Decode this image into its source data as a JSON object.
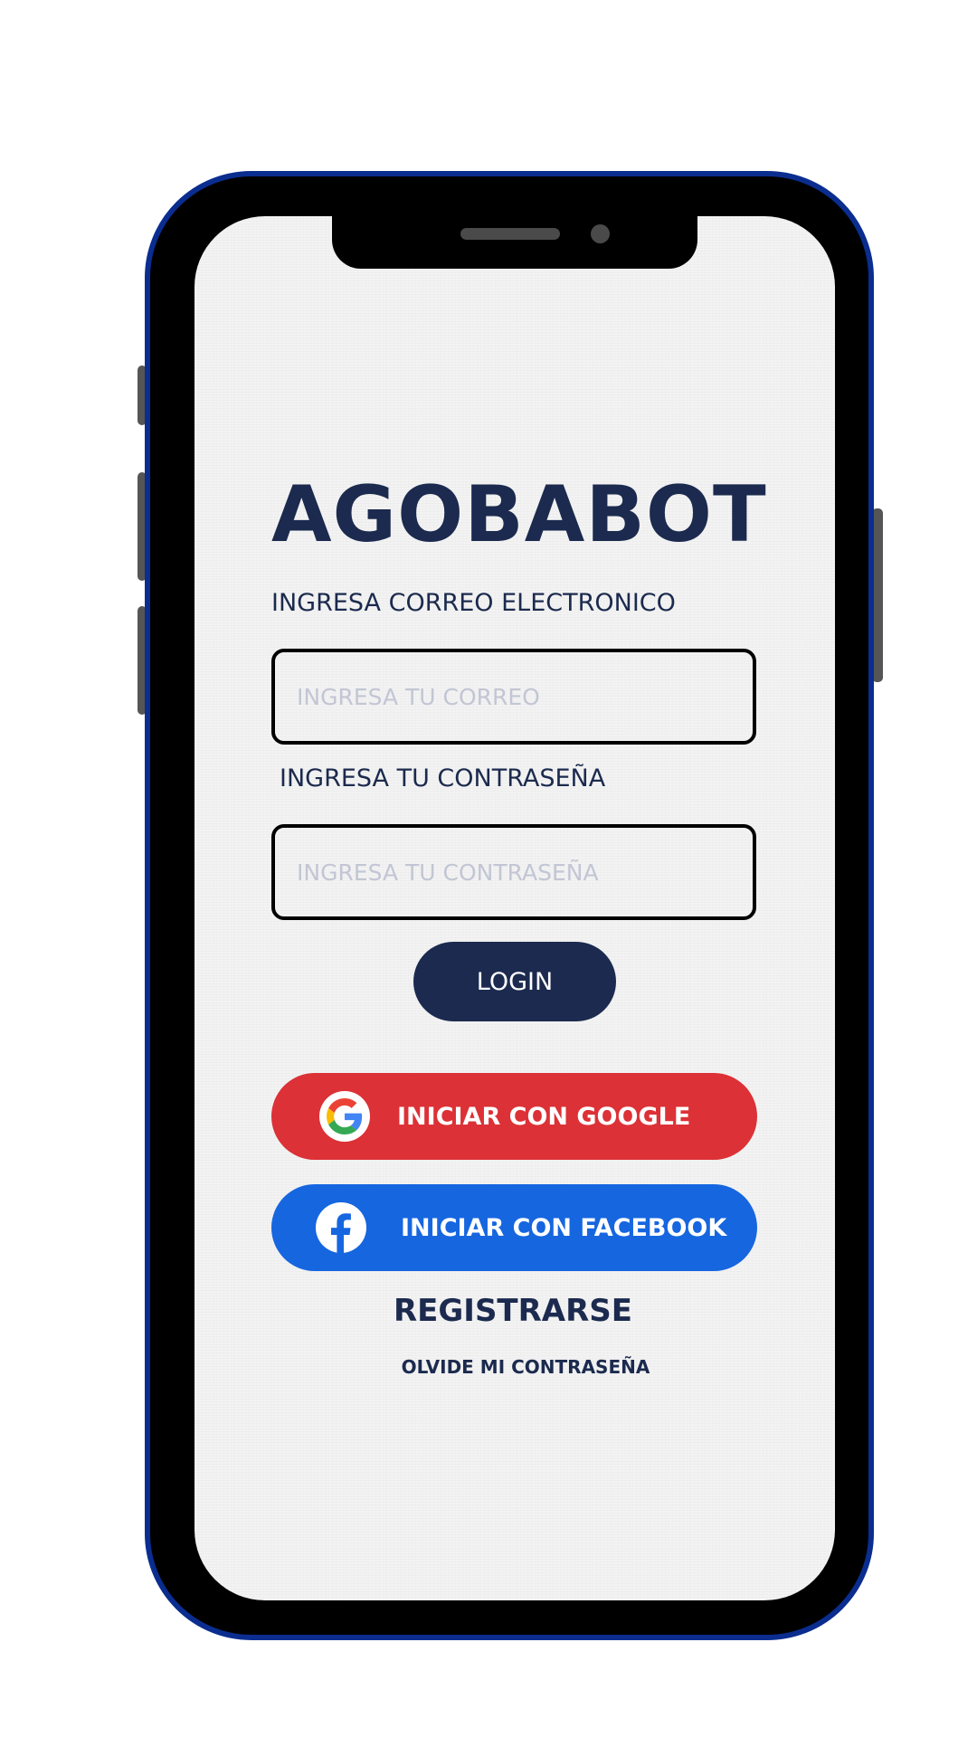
{
  "app": {
    "title": "AGOBABOT"
  },
  "email": {
    "label": "INGRESA CORREO ELECTRONICO",
    "placeholder": "INGRESA TU CORREO",
    "value": ""
  },
  "password": {
    "label": "INGRESA TU CONTRASEÑA",
    "placeholder": "INGRESA TU CONTRASEÑA",
    "value": ""
  },
  "actions": {
    "login_label": "LOGIN",
    "google_label": "INICIAR CON GOOGLE",
    "facebook_label": "INICIAR CON FACEBOOK",
    "register_label": "REGISTRARSE",
    "forgot_label": "OLVIDE MI CONTRASEÑA"
  },
  "icons": {
    "google": "google-icon",
    "facebook": "facebook-icon"
  },
  "colors": {
    "primary": "#1b2a4e",
    "google_button": "#dc3136",
    "facebook_button": "#1666e0",
    "phone_frame": "#0a2d8f",
    "screen_background": "#f3f3f3"
  }
}
